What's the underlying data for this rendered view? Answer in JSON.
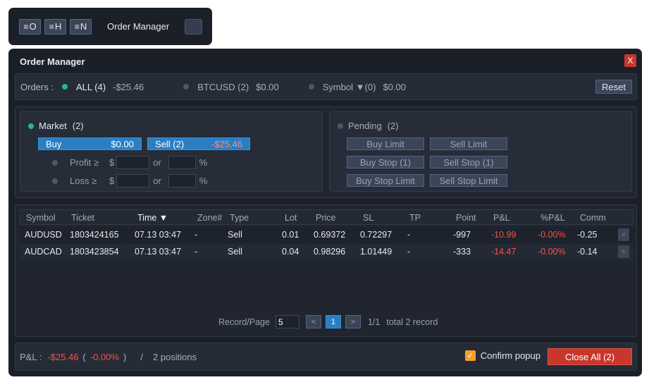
{
  "toolbar": {
    "buttons": [
      {
        "icon": "menu-lines-icon",
        "glyph": "≡",
        "letter": "O"
      },
      {
        "icon": "menu-lines-icon",
        "glyph": "≡",
        "letter": "H"
      },
      {
        "icon": "menu-lines-icon",
        "glyph": "≡",
        "letter": "N"
      }
    ],
    "title": "Order Manager"
  },
  "window": {
    "title": "Order Manager",
    "close_label": "X"
  },
  "orders_bar": {
    "label": "Orders :",
    "filters": [
      {
        "name": "ALL (4)",
        "value": "-$25.46",
        "active": true
      },
      {
        "name": "BTCUSD (2)",
        "value": "$0.00",
        "active": false
      },
      {
        "name": "Symbol ▼(0)",
        "value": "$0.00",
        "active": false
      }
    ],
    "reset_label": "Reset"
  },
  "market": {
    "title": "Market",
    "count": "(2)",
    "buy_label": "Buy",
    "buy_value": "$0.00",
    "sell_label": "Sell  (2)",
    "sell_value": "-$25.46",
    "profit_label": "Profit ≥",
    "loss_label": "Loss ≥",
    "currency": "$",
    "or_label": "or",
    "percent": "%"
  },
  "pending": {
    "title": "Pending",
    "count": "(2)",
    "buttons": [
      "Buy Limit",
      "Sell Limit",
      "Buy Stop  (1)",
      "Sell Stop  (1)",
      "Buy Stop Limit",
      "Sell Stop Limit"
    ]
  },
  "table": {
    "columns": [
      "Symbol",
      "Ticket",
      "Time ▼",
      "Zone#",
      "Type",
      "Lot",
      "Price",
      "SL",
      "TP",
      "Point",
      "P&L",
      "%P&L",
      "Comm"
    ],
    "rows": [
      {
        "symbol": "AUDUSD",
        "ticket": "1803424165",
        "time": "07.13 03:47",
        "zone": "-",
        "type": "Sell",
        "lot": "0.01",
        "price": "0.69372",
        "sl": "0.72297",
        "tp": "-",
        "point": "-997",
        "pnl": "-10.99",
        "pct": "-0.00%",
        "comm": "-0.25"
      },
      {
        "symbol": "AUDCAD",
        "ticket": "1803423854",
        "time": "07.13 03:47",
        "zone": "-",
        "type": "Sell",
        "lot": "0.04",
        "price": "0.98296",
        "sl": "1.01449",
        "tp": "-",
        "point": "-333",
        "pnl": "-14.47",
        "pct": "-0.00%",
        "comm": "-0.14"
      }
    ],
    "delete_glyph": "×"
  },
  "pager": {
    "label": "Record/Page",
    "per_page": "5",
    "prev": "<",
    "current": "1",
    "next": ">",
    "info": "1/1",
    "total": "total 2 record"
  },
  "footer": {
    "pnl_label": "P&L :",
    "pnl_value": "-$25.46",
    "open_paren": "(",
    "pnl_pct": "-0.00%",
    "close_paren": ")",
    "slash": "/",
    "positions": "2 positions",
    "confirm_label": "Confirm popup",
    "confirm_checked": "✓",
    "close_all_label": "Close All  (2)"
  },
  "colors": {
    "accent_blue": "#2b7fc1",
    "danger_red": "#c9372c",
    "negative_text": "#f0544a",
    "active_dot": "#2ab39a",
    "checkbox": "#f59f2a"
  }
}
